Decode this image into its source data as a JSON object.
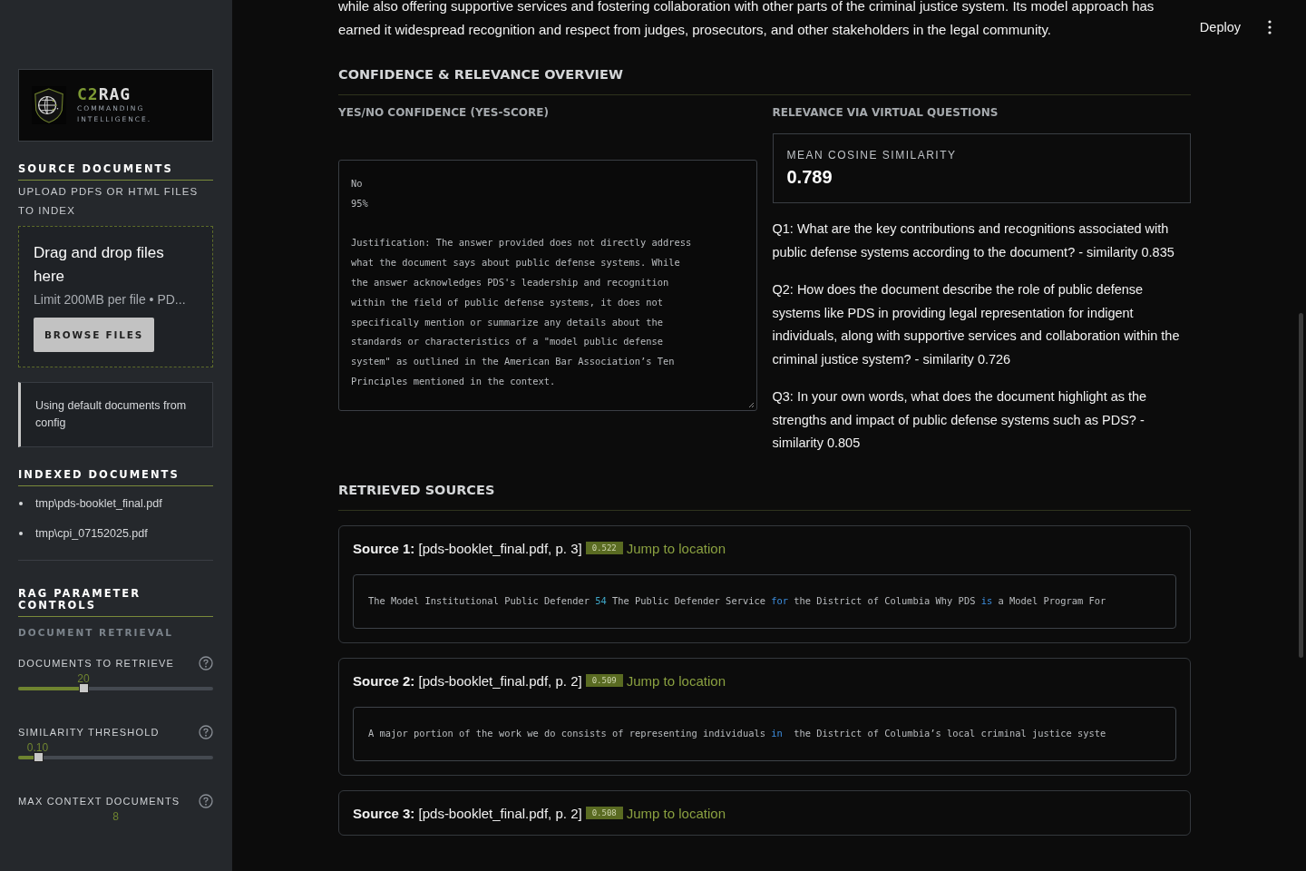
{
  "sidebar": {
    "logo": {
      "name_a": "C2",
      "name_b": "RAG",
      "tagline_1": "COMMANDING",
      "tagline_2": "INTELLIGENCE."
    },
    "source_documents": {
      "title": "SOURCE DOCUMENTS",
      "caption": "UPLOAD PDFS OR HTML FILES TO INDEX",
      "dropzone": {
        "title": "Drag and drop files here",
        "limit": "Limit 200MB per file • PD...",
        "button": "BROWSE FILES"
      },
      "notice": "Using default documents from config"
    },
    "indexed_documents": {
      "title": "INDEXED DOCUMENTS",
      "items": [
        "tmp\\pds-booklet_final.pdf",
        "tmp\\cpi_07152025.pdf"
      ]
    },
    "rag_controls": {
      "title": "RAG PARAMETER CONTROLS",
      "subtitle": "DOCUMENT RETRIEVAL",
      "sliders": [
        {
          "kind": "slider",
          "label": "DOCUMENTS TO RETRIEVE",
          "value": "20",
          "level": 0.335
        },
        {
          "kind": "slider",
          "label": "SIMILARITY THRESHOLD",
          "value": "0.10",
          "level": 0.1
        },
        {
          "kind": "label",
          "label": "MAX CONTEXT DOCUMENTS",
          "value": "8"
        }
      ]
    }
  },
  "header": {
    "deploy": "Deploy"
  },
  "answer_tail": "while also offering supportive services and fostering collaboration with other parts of the criminal justice system. Its model approach has earned it widespread recognition and respect from judges, prosecutors, and other stakeholders in the legal community.",
  "overview": {
    "title": "CONFIDENCE & RELEVANCE OVERVIEW",
    "confidence": {
      "title": "YES/NO CONFIDENCE (YES-SCORE)",
      "verdict": "No",
      "score": "95%",
      "justification": "Justification: The answer provided does not directly address what the document says about public defense systems. While the answer acknowledges PDS's leadership and recognition within the field of public defense systems, it does not specifically mention or summarize any details about the standards or characteristics of a \"model public defense system\" as outlined in the American Bar Association’s Ten Principles mentioned in the context."
    },
    "relevance": {
      "title": "RELEVANCE VIA VIRTUAL QUESTIONS",
      "metric_label": "MEAN COSINE SIMILARITY",
      "metric_value": "0.789",
      "questions": [
        "Q1: What are the key contributions and recognitions associated with public defense systems according to the document? - similarity 0.835",
        "Q2: How does the document describe the role of public defense systems like PDS in providing legal representation for indigent individuals, along with supportive services and collaboration within the criminal justice system? - similarity 0.726",
        "Q3: In your own words, what does the document highlight as the strengths and impact of public defense systems such as PDS? - similarity 0.805"
      ]
    }
  },
  "retrieved_sources": {
    "title": "RETRIEVED SOURCES",
    "sources": [
      {
        "label": "Source 1:",
        "ref": "[pds-booklet_final.pdf, p. 3]",
        "score": "0.522",
        "link": "Jump to location",
        "snippet": [
          {
            "kind": "plain",
            "text": "The Model Institutional Public Defender "
          },
          {
            "kind": "number",
            "text": "54"
          },
          {
            "kind": "plain",
            "text": " The Public Defender Service "
          },
          {
            "kind": "keyword",
            "text": "for"
          },
          {
            "kind": "plain",
            "text": " the District of Columbia Why PDS "
          },
          {
            "kind": "keyword",
            "text": "is"
          },
          {
            "kind": "plain",
            "text": " a Model Program For"
          }
        ]
      },
      {
        "label": "Source 2:",
        "ref": "[pds-booklet_final.pdf, p. 2]",
        "score": "0.509",
        "link": "Jump to location",
        "snippet": [
          {
            "kind": "plain",
            "text": "A major portion of the work we do consists of representing individuals "
          },
          {
            "kind": "keyword",
            "text": "in"
          },
          {
            "kind": "plain",
            "text": "  the District of Columbia’s local criminal justice syste"
          }
        ]
      },
      {
        "label": "Source 3:",
        "ref": "[pds-booklet_final.pdf, p. 2]",
        "score": "0.508",
        "link": "Jump to location"
      }
    ]
  }
}
